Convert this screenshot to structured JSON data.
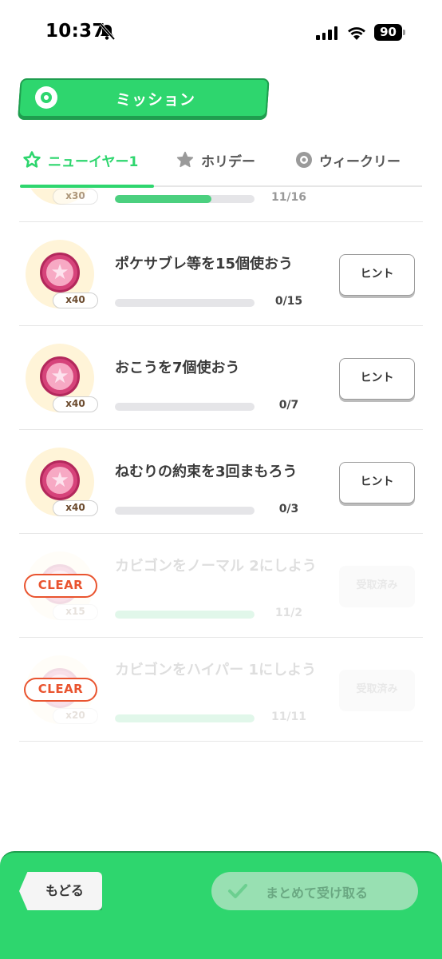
{
  "status_bar": {
    "time": "10:37",
    "battery": "90"
  },
  "header": {
    "title": "ミッション"
  },
  "tabs": [
    {
      "label": "ニューイヤー1",
      "active": true
    },
    {
      "label": "ホリデー",
      "active": false
    },
    {
      "label": "ウィークリー",
      "active": false
    }
  ],
  "missions": [
    {
      "title": "",
      "reward": "x30",
      "progress_text": "11/16",
      "progress": 0.69,
      "button": "",
      "state": "partial"
    },
    {
      "title": "ポケサブレ等を15個使おう",
      "reward": "x40",
      "progress_text": "0/15",
      "progress": 0,
      "button": "ヒント",
      "state": "open"
    },
    {
      "title": "おこうを7個使おう",
      "reward": "x40",
      "progress_text": "0/7",
      "progress": 0,
      "button": "ヒント",
      "state": "open"
    },
    {
      "title": "ねむりの約束を3回まもろう",
      "reward": "x40",
      "progress_text": "0/3",
      "progress": 0,
      "button": "ヒント",
      "state": "open"
    },
    {
      "title": "カビゴンをノーマル 2にしよう",
      "reward": "x15",
      "progress_text": "11/2",
      "progress": 1,
      "button": "受取済み",
      "state": "cleared",
      "badge": "CLEAR"
    },
    {
      "title": "カビゴンをハイパー 1にしよう",
      "reward": "x20",
      "progress_text": "11/11",
      "progress": 1,
      "button": "受取済み",
      "state": "cleared",
      "badge": "CLEAR"
    }
  ],
  "footer": {
    "back_label": "もどる",
    "claim_all_label": "まとめて受け取る"
  },
  "colors": {
    "accent": "#2ed66e",
    "clear": "#e9542f",
    "medal": "#d6437a"
  }
}
